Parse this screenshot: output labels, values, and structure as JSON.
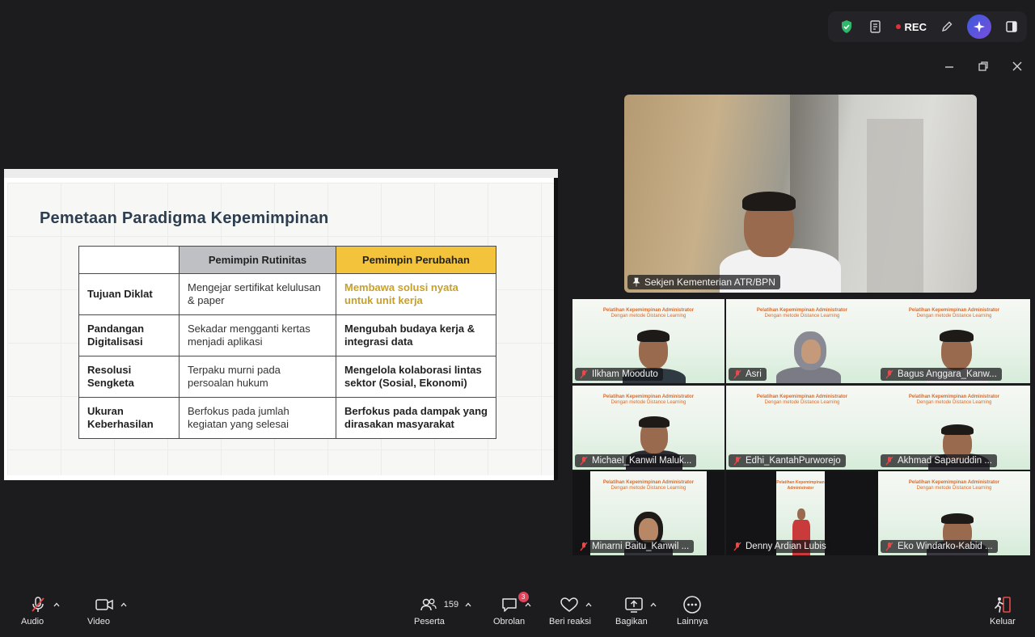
{
  "toolbar": {
    "rec_label": "REC",
    "icons": [
      "shield-icon",
      "notes-icon",
      "record-icon",
      "pen-icon",
      "ai-sparkle-icon",
      "sidebar-icon"
    ],
    "colors": {
      "shield": "#2fb86a",
      "rec_dot": "#e0303a",
      "ai_button": "#4a54d8"
    }
  },
  "window_controls": [
    "minimize-icon",
    "restore-icon",
    "close-icon"
  ],
  "shared_slide": {
    "title": "Pemetaan Paradigma Kepemimpinan",
    "columns": [
      "",
      "Pemimpin Rutinitas",
      "Pemimpin Perubahan"
    ],
    "rows": [
      {
        "head": "Tujuan Diklat",
        "rutin": "Mengejar sertifikat kelulusan & paper",
        "ubah": "Membawa solusi nyata untuk unit kerja"
      },
      {
        "head": "Pandangan Digitalisasi",
        "rutin": "Sekadar mengganti kertas menjadi aplikasi",
        "ubah": "Mengubah budaya kerja & integrasi data"
      },
      {
        "head": "Resolusi Sengketa",
        "rutin": "Terpaku murni pada persoalan hukum",
        "ubah": "Mengelola kolaborasi lintas sektor (Sosial, Ekonomi)"
      },
      {
        "head": "Ukuran Keberhasilan",
        "rutin": "Berfokus pada jumlah kegiatan yang selesai",
        "ubah": "Berfokus pada dampak yang dirasakan masyarakat"
      }
    ],
    "colors": {
      "rutin_header": "#bfc0c3",
      "ubah_header": "#f3c33c",
      "highlight_text": "#c7a02c"
    }
  },
  "speaker": {
    "name": "Sekjen Kementerian ATR/BPN"
  },
  "gallery": {
    "slide_text_line1": "Pelatihan Kepemimpinan Administrator",
    "slide_text_line2": "Dengan metode Distance Learning",
    "participants": [
      {
        "name": "Ilkham Mooduto"
      },
      {
        "name": "Asri"
      },
      {
        "name": "Bagus Anggara_Kanw..."
      },
      {
        "name": "Michael_Kanwil Maluk..."
      },
      {
        "name": "Edhi_KantahPurworejo"
      },
      {
        "name": "Akhmad Saparuddin ..."
      },
      {
        "name": "Minarni Baitu_Kanwil ..."
      },
      {
        "name": "Denny Ardian Lubis"
      },
      {
        "name": "Eko Windarko-Kabid ..."
      }
    ]
  },
  "bottom_bar": {
    "audio": "Audio",
    "video": "Video",
    "participants_label": "Peserta",
    "participants_count": "159",
    "chat_label": "Obrolan",
    "chat_badge": "3",
    "reactions": "Beri reaksi",
    "share": "Bagikan",
    "more": "Lainnya",
    "leave": "Keluar"
  }
}
